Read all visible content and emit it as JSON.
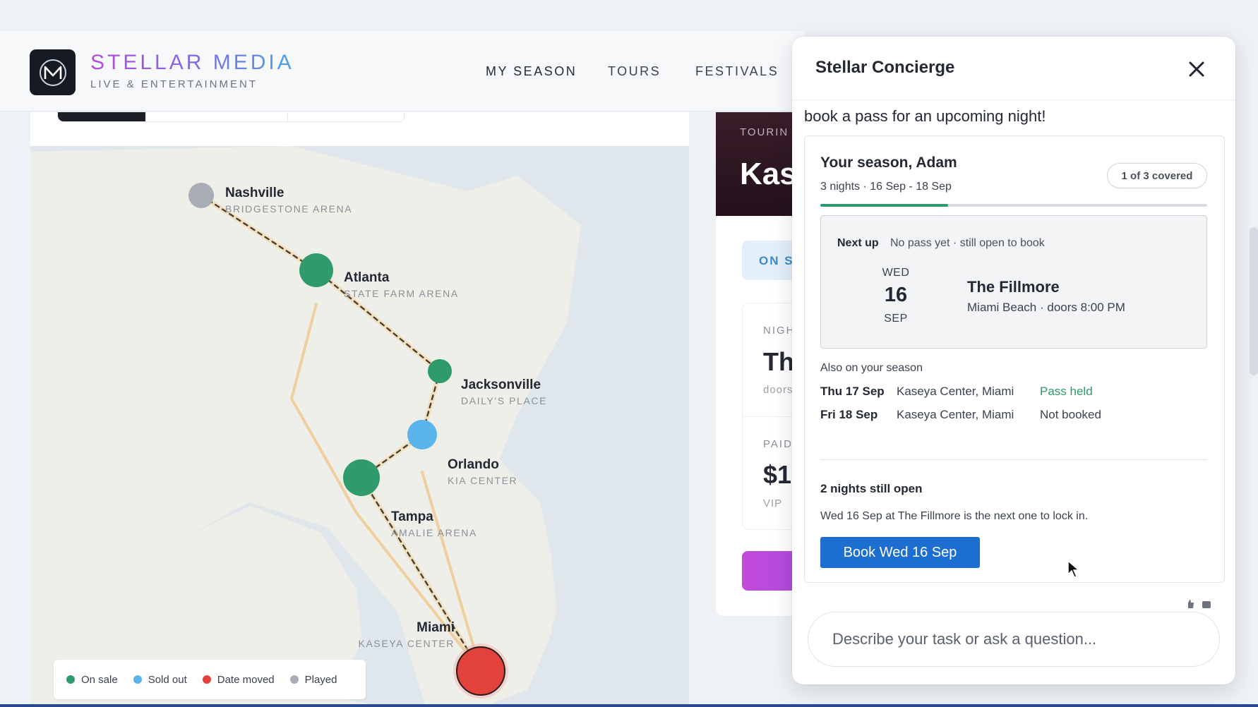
{
  "brand": {
    "name": "STELLAR MEDIA",
    "tagline": "LIVE & ENTERTAINMENT",
    "logo_letter": "M"
  },
  "nav": {
    "items": [
      {
        "label": "MY SEASON",
        "active": true
      },
      {
        "label": "TOURS",
        "active": false
      },
      {
        "label": "FESTIVALS",
        "active": false
      }
    ]
  },
  "map": {
    "cities": [
      {
        "name": "Nashville",
        "venue": "BRIDGESTONE ARENA",
        "status": "played"
      },
      {
        "name": "Atlanta",
        "venue": "STATE FARM ARENA",
        "status": "on-sale"
      },
      {
        "name": "Jacksonville",
        "venue": "DAILY'S PLACE",
        "status": "on-sale"
      },
      {
        "name": "Orlando",
        "venue": "KIA CENTER",
        "status": "sold-out"
      },
      {
        "name": "Tampa",
        "venue": "AMALIE ARENA",
        "status": "on-sale"
      },
      {
        "name": "Miami",
        "venue": "KASEYA CENTER",
        "status": "date-moved"
      }
    ],
    "legend": [
      {
        "label": "On sale",
        "color": "#2f9a6b"
      },
      {
        "label": "Sold out",
        "color": "#5ab4ec"
      },
      {
        "label": "Date moved",
        "color": "#e2413c"
      },
      {
        "label": "Played",
        "color": "#a9adb5"
      }
    ]
  },
  "tour_card": {
    "eyebrow": "TOURIN",
    "title": "Kas",
    "status": "ON S",
    "night_label": "NIGH",
    "night_value": "Th",
    "doors": "doors",
    "paid_label": "PAID",
    "paid_value": "$1,",
    "tier": "VIP"
  },
  "concierge": {
    "title": "Stellar Concierge",
    "intro": "book a pass for an upcoming night!",
    "season": {
      "title": "Your season, Adam",
      "subtitle": "3 nights · 16 Sep - 18 Sep",
      "covered": "1 of 3 covered",
      "progress": 0.33
    },
    "next_up": {
      "label": "Next up",
      "status": "No pass yet · still open to book",
      "dow": "WED",
      "day": "16",
      "month": "SEP",
      "venue": "The Fillmore",
      "meta": "Miami Beach · doors 8:00 PM"
    },
    "also_heading": "Also on your season",
    "also": [
      {
        "date": "Thu 17 Sep",
        "venue": "Kaseya Center, Miami",
        "status": "Pass held",
        "state": "held"
      },
      {
        "date": "Fri 18 Sep",
        "venue": "Kaseya Center, Miami",
        "status": "Not booked",
        "state": "open"
      }
    ],
    "open_title": "2 nights still open",
    "open_text": "Wed 16 Sep at The Fillmore is the next one to lock in.",
    "book_label": "Book Wed 16 Sep",
    "input_placeholder": "Describe your task or ask a question..."
  }
}
